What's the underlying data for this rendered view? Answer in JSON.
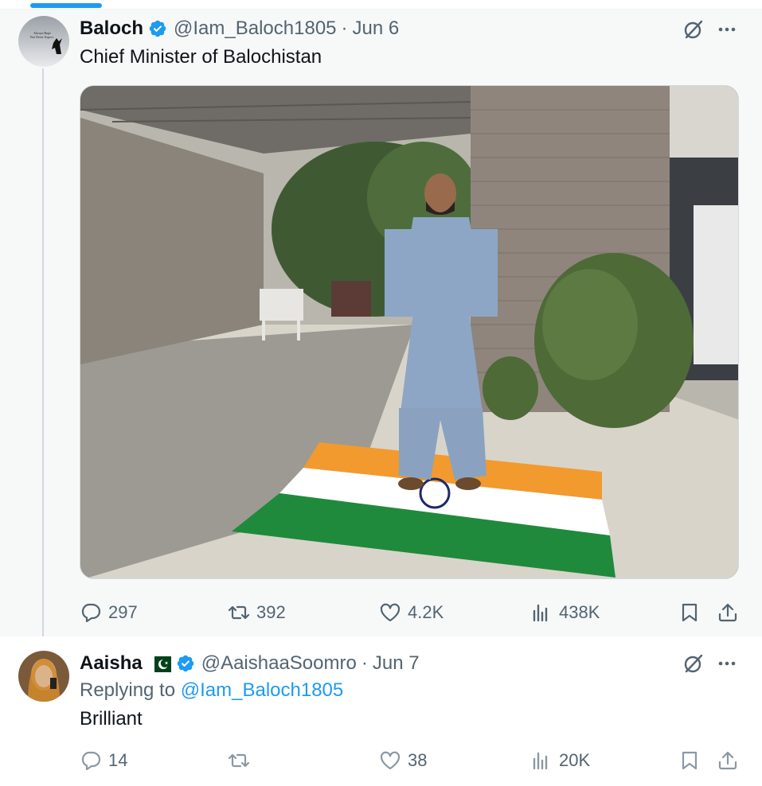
{
  "colors": {
    "accent": "#1d9bf0",
    "text": "#0f1419",
    "muted": "#536471"
  },
  "tweet": {
    "name": "Baloch",
    "handle": "@Iam_Baloch1805",
    "sep": "·",
    "date": "Jun 6",
    "text": "Chief Minister of Balochistan",
    "avatar_text": "Always Hope But Never Expect.",
    "icons": {
      "grok": "grok-icon",
      "more": "more-icon",
      "verified": "verified-badge-icon"
    },
    "media_description_icon": "photo",
    "stats": {
      "replies": "297",
      "reposts": "392",
      "likes": "4.2K",
      "views": "438K"
    }
  },
  "reply": {
    "name": "Aaisha",
    "handle": "@AaishaaSoomro",
    "sep": "·",
    "date": "Jun 7",
    "replying_prefix": "Replying to",
    "replying_to": "@Iam_Baloch1805",
    "text": "Brilliant",
    "icons": {
      "flag": "pakistan-flag-icon",
      "grok": "grok-icon",
      "more": "more-icon"
    },
    "stats": {
      "replies": "14",
      "reposts": "",
      "likes": "38",
      "views": "20K"
    }
  }
}
